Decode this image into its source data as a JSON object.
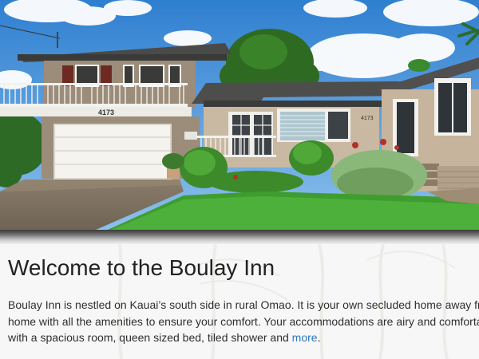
{
  "hero": {
    "house_number_main": "4173",
    "house_number_side": "4173"
  },
  "welcome": {
    "title": "Welcome to the Boulay Inn",
    "intro_text": "Boulay Inn is nestled on Kauai’s south side in rural Omao. It is your own secluded home away from home with all the amenities to ensure your comfort. Your accommodations are airy and comfortable with a spacious room, queen sized bed, tiled shower and ",
    "more_link": "more",
    "intro_end": "."
  },
  "colors": {
    "link": "#2a78c2",
    "title": "#222222",
    "body_text": "#2f2f2f"
  }
}
